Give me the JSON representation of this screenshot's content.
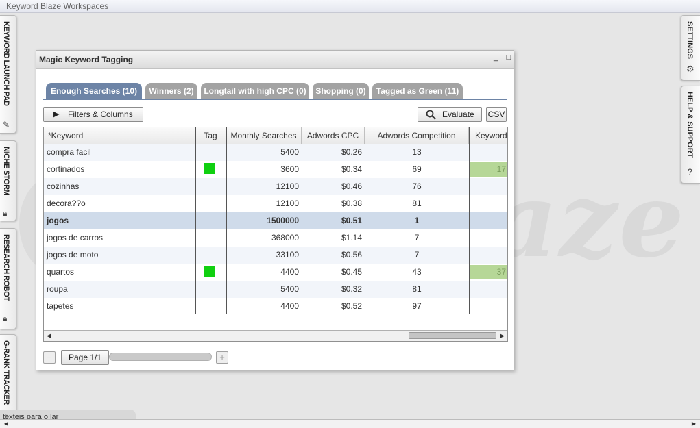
{
  "app": {
    "title": "Keyword Blaze Workspaces",
    "watermark": "laze"
  },
  "left_tabs": [
    {
      "label": "KEYWORD LAUNCH PAD",
      "icon": "wrench-icon"
    },
    {
      "label": "NICHE STORM",
      "icon": "lock-icon"
    },
    {
      "label": "RESEARCH ROBOT",
      "icon": "lock-icon"
    },
    {
      "label": "G-RANK TRACKER",
      "icon": ""
    }
  ],
  "right_tabs": [
    {
      "label": "SETTINGS",
      "icon": "gear-icon"
    },
    {
      "label": "HELP & SUPPORT",
      "icon": "question-icon"
    }
  ],
  "window": {
    "title": "Magic Keyword Tagging",
    "minimize": "_",
    "maximize": "□",
    "tabs": [
      {
        "label": "Enough Searches (10)",
        "active": true
      },
      {
        "label": "Winners (2)",
        "active": false
      },
      {
        "label": "Longtail with high CPC (0)",
        "active": false
      },
      {
        "label": "Shopping (0)",
        "active": false
      },
      {
        "label": "Tagged as Green (11)",
        "active": false
      }
    ],
    "toolbar": {
      "filters_label": "Filters & Columns",
      "evaluate_label": "Evaluate",
      "csv_label": "CSV"
    },
    "columns": [
      "*Keyword",
      "Tag",
      "Monthly Searches",
      "Adwords CPC",
      "Adwords Competition",
      "Keyword"
    ],
    "rows": [
      {
        "keyword": "compra facil",
        "tag": false,
        "searches": "5400",
        "cpc": "$0.26",
        "competition": "13",
        "kw": ""
      },
      {
        "keyword": "cortinados",
        "tag": true,
        "searches": "3600",
        "cpc": "$0.34",
        "competition": "69",
        "kw": "17"
      },
      {
        "keyword": "cozinhas",
        "tag": false,
        "searches": "12100",
        "cpc": "$0.46",
        "competition": "76",
        "kw": ""
      },
      {
        "keyword": "decora??o",
        "tag": false,
        "searches": "12100",
        "cpc": "$0.38",
        "competition": "81",
        "kw": ""
      },
      {
        "keyword": "jogos",
        "tag": false,
        "searches": "1500000",
        "cpc": "$0.51",
        "competition": "1",
        "kw": "",
        "selected": true
      },
      {
        "keyword": "jogos de carros",
        "tag": false,
        "searches": "368000",
        "cpc": "$1.14",
        "competition": "7",
        "kw": ""
      },
      {
        "keyword": "jogos de moto",
        "tag": false,
        "searches": "33100",
        "cpc": "$0.56",
        "competition": "7",
        "kw": ""
      },
      {
        "keyword": "quartos",
        "tag": true,
        "searches": "4400",
        "cpc": "$0.45",
        "competition": "43",
        "kw": "37"
      },
      {
        "keyword": "roupa",
        "tag": false,
        "searches": "5400",
        "cpc": "$0.32",
        "competition": "81",
        "kw": ""
      },
      {
        "keyword": "tapetes",
        "tag": false,
        "searches": "4400",
        "cpc": "$0.52",
        "competition": "97",
        "kw": ""
      }
    ],
    "pager": {
      "minus": "−",
      "label": "Page 1/1",
      "plus": "+"
    }
  },
  "bottom": {
    "tab_label": "têxteis para o lar"
  },
  "colors": {
    "active_tab": "#6d84a6",
    "inactive_tab": "#a3a3a3",
    "tag_green": "#10d010",
    "kw_bar": "#b6d797",
    "selected_row": "#cfdbea"
  }
}
